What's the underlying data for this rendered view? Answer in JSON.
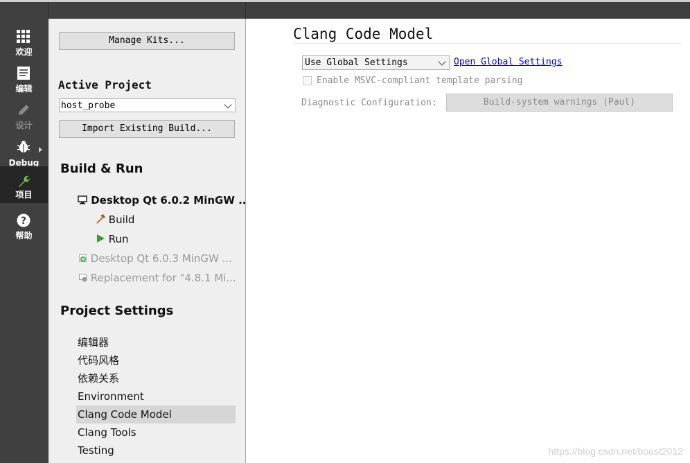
{
  "modes": [
    {
      "label": "欢迎",
      "icon": "grid-icon"
    },
    {
      "label": "编辑",
      "icon": "document-icon"
    },
    {
      "label": "设计",
      "icon": "pencil-icon"
    },
    {
      "label": "Debug",
      "icon": "bug-icon"
    },
    {
      "label": "项目",
      "icon": "wrench-icon"
    },
    {
      "label": "帮助",
      "icon": "help-icon"
    }
  ],
  "left": {
    "manage_kits": "Manage Kits...",
    "active_project_label": "Active Project",
    "active_project_value": "host_probe",
    "import_build": "Import Existing Build...",
    "build_run_title": "Build & Run",
    "kit_active": "Desktop Qt 6.0.2 MinGW ...",
    "build": "Build",
    "run": "Run",
    "kit_other1": "Desktop Qt 6.0.3 MinGW ...",
    "kit_other2": "Replacement for \"4.8.1 Mi...",
    "project_settings_title": "Project Settings",
    "settings": [
      "编辑器",
      "代码风格",
      "依赖关系",
      "Environment",
      "Clang Code Model",
      "Clang Tools",
      "Testing"
    ],
    "selected_setting": "Clang Code Model"
  },
  "main": {
    "title": "Clang Code Model",
    "settings_combo": "Use Global Settings",
    "open_global": "Open Global Settings",
    "msvc_label": "Enable MSVC-compliant template parsing",
    "diag_label": "Diagnostic Configuration:",
    "diag_button": "Build-system warnings (Paul)"
  },
  "watermark": "https://blog.csdn.net/boost2012",
  "colors": {
    "modebar": "#404040",
    "active_mode": "#262626",
    "link": "#0000ee",
    "run_green": "#3b9b2d",
    "build_orange": "#c8742a"
  }
}
